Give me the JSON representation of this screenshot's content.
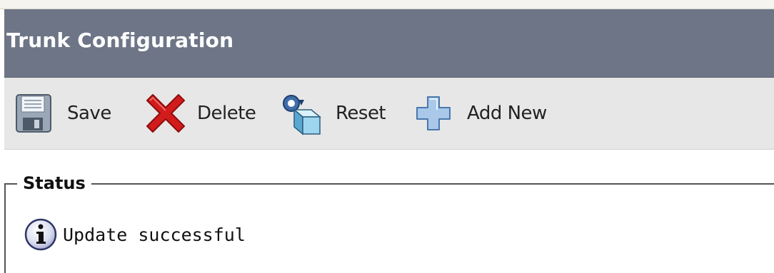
{
  "header": {
    "title": "Trunk Configuration"
  },
  "toolbar": {
    "save": {
      "label": "Save",
      "icon": "floppy-disk-icon"
    },
    "delete": {
      "label": "Delete",
      "icon": "red-x-icon"
    },
    "reset": {
      "label": "Reset",
      "icon": "reset-icon"
    },
    "add_new": {
      "label": "Add New",
      "icon": "blue-plus-icon"
    }
  },
  "status": {
    "legend": "Status",
    "icon": "info-icon",
    "message": "Update successful"
  },
  "colors": {
    "title_bar": "#6d7587",
    "toolbar": "#e7e7e7",
    "delete_red": "#d21b1b",
    "plus_blue": "#8ab4e0"
  }
}
